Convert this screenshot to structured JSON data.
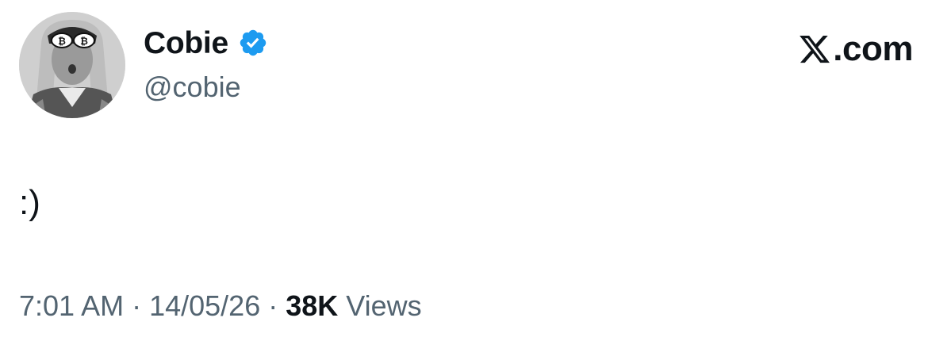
{
  "author": {
    "display_name": "Cobie",
    "handle": "@cobie",
    "verified": true,
    "verified_badge_color": "#1d9bf0",
    "avatar_icon": "avatar-photo"
  },
  "brand": {
    "icon": "x-logo-icon",
    "text": ".com"
  },
  "tweet": {
    "text": ":)"
  },
  "meta": {
    "time": "7:01 AM",
    "separator": "·",
    "date": "14/05/26",
    "views_count": "38K",
    "views_label": "Views"
  },
  "colors": {
    "text_primary": "#0f1419",
    "text_secondary": "#536471",
    "background": "#ffffff"
  }
}
